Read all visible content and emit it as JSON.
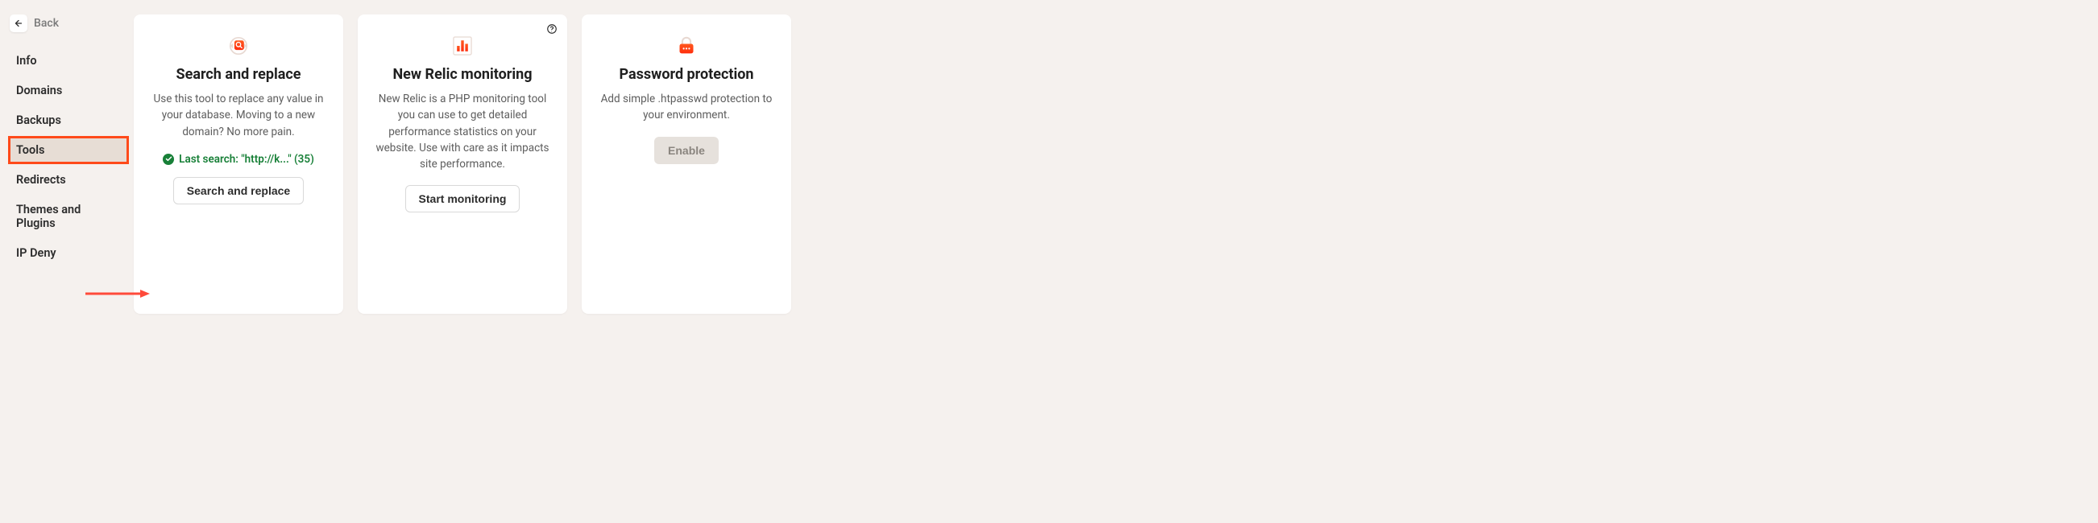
{
  "sidebar": {
    "back_label": "Back",
    "items": [
      {
        "label": "Info"
      },
      {
        "label": "Domains"
      },
      {
        "label": "Backups"
      },
      {
        "label": "Tools"
      },
      {
        "label": "Redirects"
      },
      {
        "label": "Themes and Plugins"
      },
      {
        "label": "IP Deny"
      }
    ],
    "active_index": 3
  },
  "cards": {
    "search_replace": {
      "title": "Search and replace",
      "description": "Use this tool to replace any value in your database. Moving to a new domain? No more pain.",
      "status": "Last search: \"http://k...\" (35)",
      "button": "Search and replace"
    },
    "new_relic": {
      "title": "New Relic monitoring",
      "description": "New Relic is a PHP monitoring tool you can use to get detailed performance statistics on your website. Use with care as it impacts site performance.",
      "button": "Start monitoring"
    },
    "password_protection": {
      "title": "Password protection",
      "description": "Add simple .htpasswd protection to your environment.",
      "button": "Enable"
    }
  }
}
